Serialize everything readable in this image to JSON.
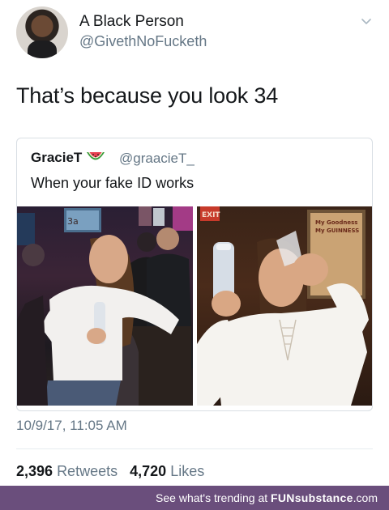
{
  "author": {
    "name": "A Black Person",
    "handle": "@GivethNoFucketh",
    "avatar_icon": "profile-avatar"
  },
  "tweet": {
    "text": "That’s because you look 34",
    "timestamp": "10/9/17, 11:05 AM",
    "retweets_count": "2,396",
    "retweets_label": "Retweets",
    "likes_count": "4,720",
    "likes_label": "Likes"
  },
  "quoted_tweet": {
    "name": "GracieT",
    "emoji_icon": "watermelon-icon",
    "handle": "@graacieT_",
    "text": "When your fake ID works",
    "photo_1_signage": "3a",
    "photo_2_sign_line_1": "My Goodness",
    "photo_2_sign_line_2": "My GUINNESS",
    "photo_2_exit_sign": "EXIT"
  },
  "footer": {
    "lead": "See what's trending at ",
    "brand": "FUNsubstance",
    "domain": ".com"
  },
  "colors": {
    "text": "#14171a",
    "secondary": "#657786",
    "border": "#d9dfe4",
    "footer_bg": "#6a4e7c"
  }
}
